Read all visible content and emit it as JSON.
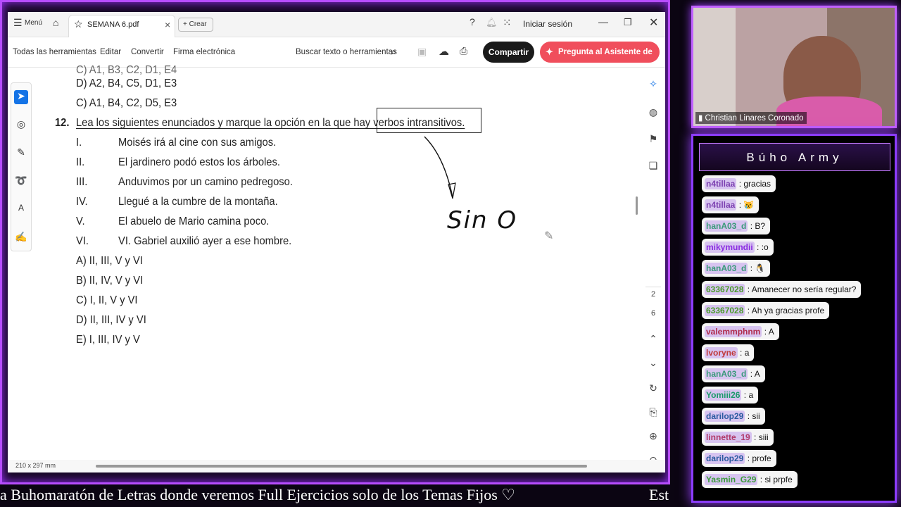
{
  "titlebar": {
    "menu_label": "Menú",
    "tab_title": "SEMANA 6.pdf",
    "tab_close": "×",
    "create_label": "+ Crear",
    "signin_label": "Iniciar sesión"
  },
  "toolbar": {
    "items": [
      "Todas las herramientas",
      "Editar",
      "Convertir",
      "Firma electrónica"
    ],
    "search_placeholder": "Buscar texto o herramientas",
    "share_label": "Compartir",
    "ai_label": "Pregunta al Asistente de IA"
  },
  "document": {
    "partial_top": "C) A1, B3, C2, D1, E4",
    "options_prev": [
      "D) A2, B4, C5, D1, E3",
      "C) A1, B4, C2, D5, E3"
    ],
    "question_number": "12.",
    "question_text": "Lea los siguientes enunciados y marque la opción en la que hay verbos intransitivos.",
    "statements": [
      {
        "num": "I.",
        "text": "Moisés irá al cine con sus amigos."
      },
      {
        "num": "II.",
        "text": "El jardinero podó estos los árboles."
      },
      {
        "num": "III.",
        "text": "Anduvimos por un camino pedregoso."
      },
      {
        "num": "IV.",
        "text": "Llegué a la cumbre de la montaña."
      },
      {
        "num": "V.",
        "text": "El abuelo de Mario camina poco."
      },
      {
        "num": "VI.",
        "text": "VI. Gabriel auxilió ayer a ese hombre."
      }
    ],
    "answers": [
      "A) II, III, V y VI",
      "B) II, IV, V y VI",
      "C) I, II, V y VI",
      "D) II, III, IV y VI",
      "E) I, III, IV y V"
    ],
    "handwriting": "Sin O"
  },
  "page_indicator": {
    "current": "2",
    "total": "6"
  },
  "status": {
    "page_size": "210 x 297 mm"
  },
  "webcam": {
    "name": "Christian Linares Coronado"
  },
  "chat": {
    "title": "Búho Army",
    "messages": [
      {
        "user": "n4tillaa",
        "text": "gracias",
        "color": "#7b3fb0"
      },
      {
        "user": "n4tillaa",
        "text": "😿",
        "color": "#7b3fb0"
      },
      {
        "user": "hanA03_d",
        "text": "B?",
        "color": "#3a9a7a"
      },
      {
        "user": "mikymundii",
        "text": ":o",
        "color": "#8a2be2"
      },
      {
        "user": "hanA03_d",
        "text": "🐧",
        "color": "#3a9a7a"
      },
      {
        "user": "63367028",
        "text": "Amanecer no sería regular?",
        "color": "#4a9a2a"
      },
      {
        "user": "63367028",
        "text": "Ah ya gracias profe",
        "color": "#4a9a2a"
      },
      {
        "user": "valemmphnm",
        "text": "A",
        "color": "#b02a4a"
      },
      {
        "user": "lvoryne",
        "text": "a",
        "color": "#c03a3a"
      },
      {
        "user": "hanA03_d",
        "text": "A",
        "color": "#3a9a7a"
      },
      {
        "user": "Yomiii26",
        "text": "a",
        "color": "#1a9a6a"
      },
      {
        "user": "darilop29",
        "text": "sii",
        "color": "#2a5aa0"
      },
      {
        "user": "linnette_19",
        "text": "siii",
        "color": "#b03a6a"
      },
      {
        "user": "darilop29",
        "text": "profe",
        "color": "#2a5aa0"
      },
      {
        "user": "Yasmin_G29",
        "text": "si prpfe",
        "color": "#3a9a3a"
      }
    ]
  },
  "ticker": {
    "text": "a Buhomaratón de Letras donde veremos Full Ejercicios solo de los Temas Fijos ♡",
    "tail": "Est"
  }
}
